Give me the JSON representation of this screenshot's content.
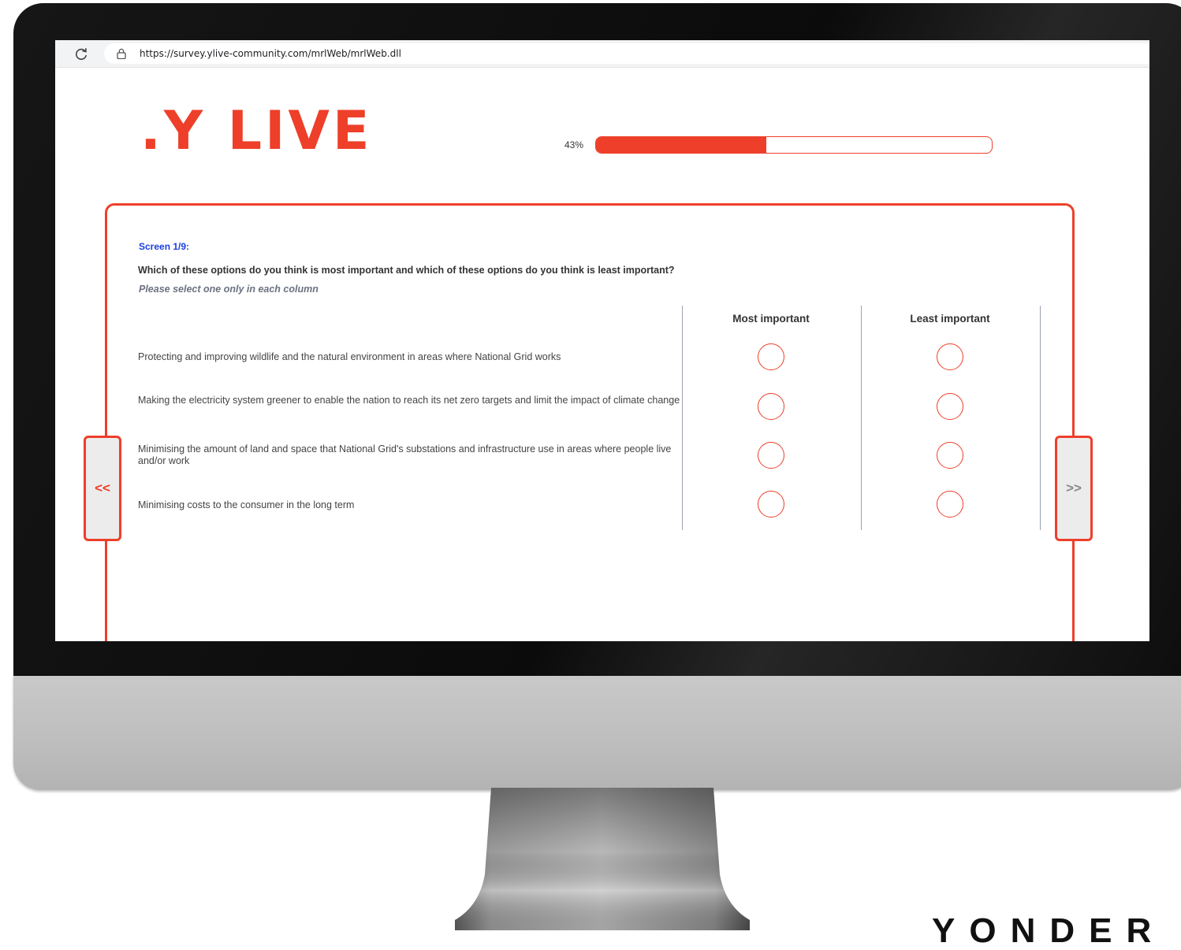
{
  "browser": {
    "reload_icon": "reload-icon",
    "lock_icon": "lock-icon",
    "url": "https://survey.ylive-community.com/mrlWeb/mrlWeb.dll"
  },
  "survey": {
    "logo": ".Y LIVE",
    "progress": {
      "label": "43%",
      "value": 0.43
    },
    "screen_label": "Screen 1/9:",
    "question": "Which of these options do you think is most important and which of these options do you think is least important?",
    "instruction": "Please select one only in each column",
    "columns": [
      "Most important",
      "Least important"
    ],
    "options": [
      {
        "text": "Protecting and improving wildlife and the natural environment in areas where National Grid works"
      },
      {
        "text": "Making the electricity system greener to enable the nation to reach its net zero targets and limit the impact of climate change"
      },
      {
        "text": "Minimising the amount of land and space that National Grid's substations and infrastructure use in areas where people live and/or work"
      },
      {
        "text": "Minimising costs to the consumer in the long term"
      }
    ],
    "prev_label": "<<",
    "next_label": ">>"
  },
  "footer": {
    "brand": "YONDER"
  },
  "colors": {
    "accent": "#ee3f2a",
    "screen_label": "#1a3fe0",
    "instruction": "#6b7280"
  }
}
